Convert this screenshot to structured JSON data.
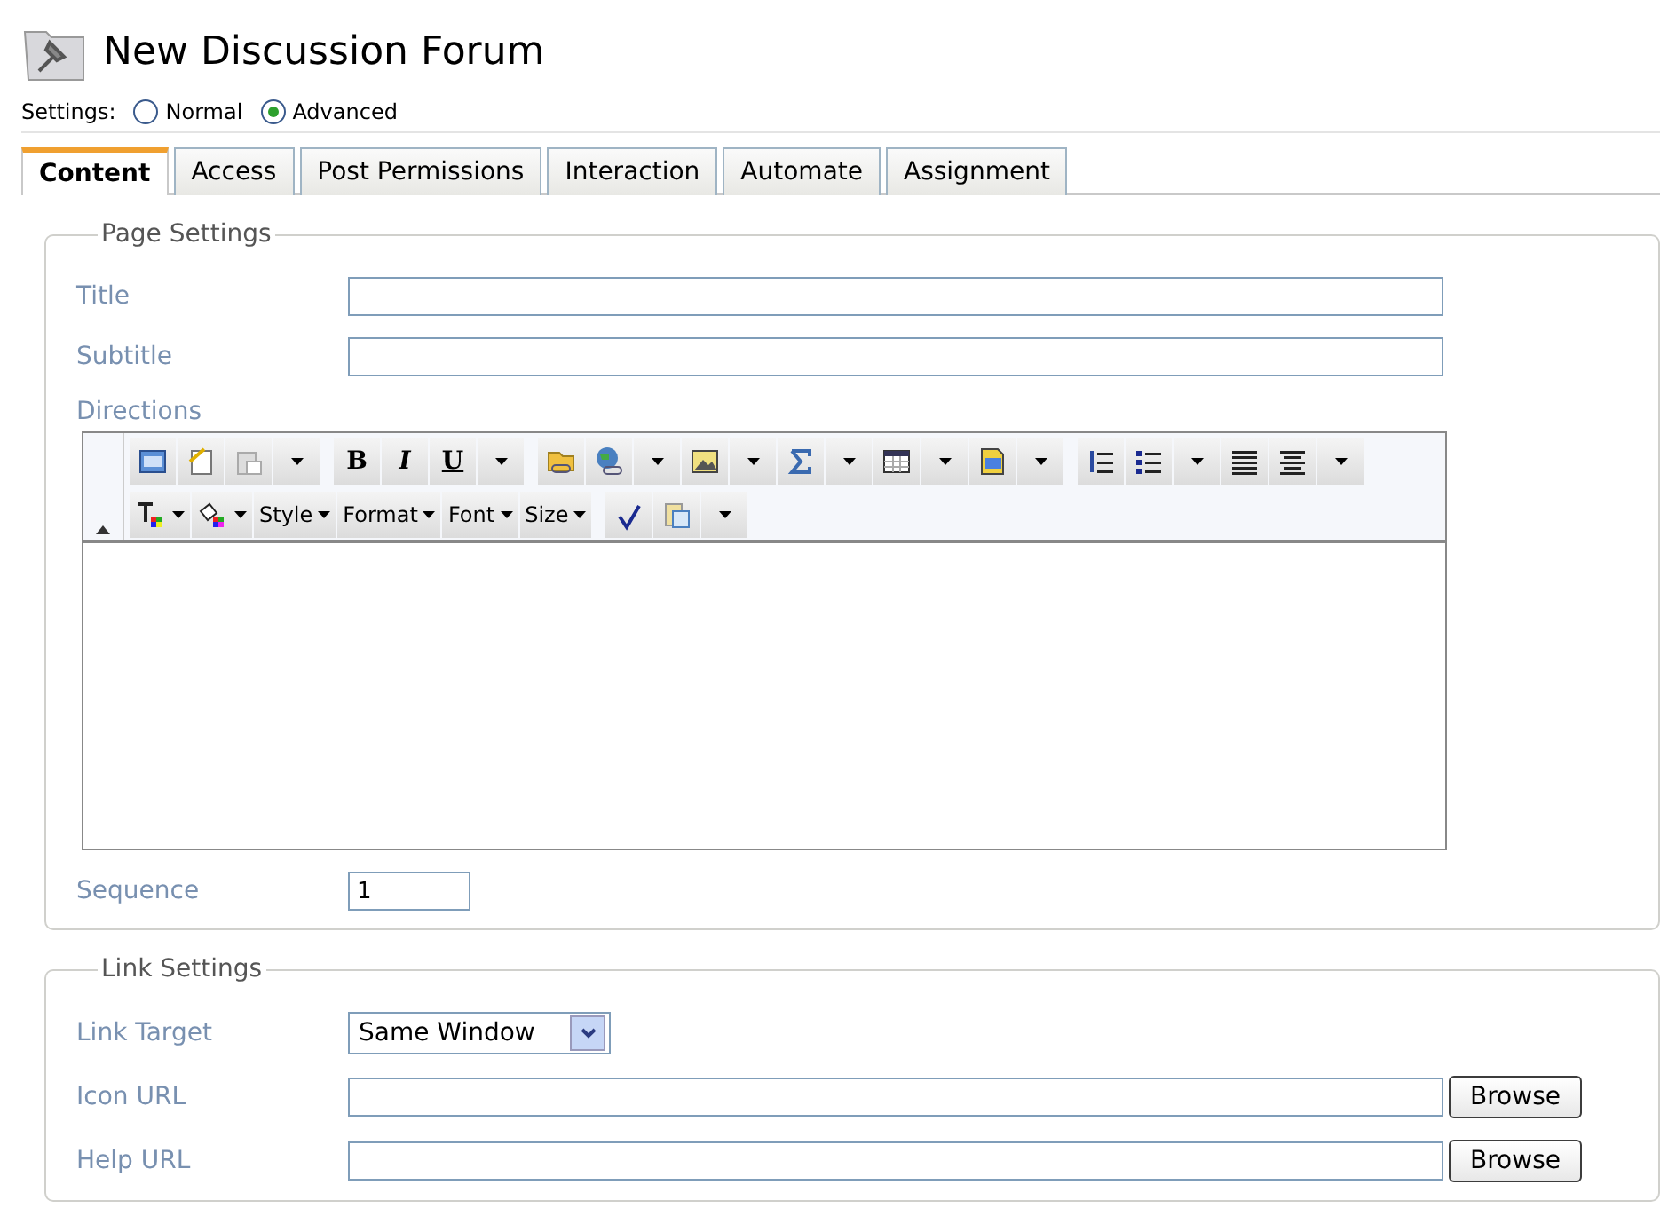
{
  "title": "New Discussion Forum",
  "settings": {
    "label": "Settings:",
    "options": [
      {
        "label": "Normal",
        "selected": false
      },
      {
        "label": "Advanced",
        "selected": true
      }
    ]
  },
  "tabs": [
    {
      "label": "Content",
      "selected": true
    },
    {
      "label": "Access",
      "selected": false
    },
    {
      "label": "Post Permissions",
      "selected": false
    },
    {
      "label": "Interaction",
      "selected": false
    },
    {
      "label": "Automate",
      "selected": false
    },
    {
      "label": "Assignment",
      "selected": false
    }
  ],
  "page_settings": {
    "legend": "Page Settings",
    "title_label": "Title",
    "subtitle_label": "Subtitle",
    "directions_label": "Directions",
    "format_buttons": [
      "B",
      "I",
      "U"
    ],
    "dropdowns": [
      "Style",
      "Format",
      "Font",
      "Size"
    ],
    "sequence_label": "Sequence",
    "sequence_value": "1"
  },
  "link_settings": {
    "legend": "Link Settings",
    "target_label": "Link Target",
    "target_value": "Same Window",
    "url_rows": [
      {
        "label": "Icon URL",
        "button": "Browse"
      },
      {
        "label": "Help URL",
        "button": "Browse"
      }
    ]
  }
}
